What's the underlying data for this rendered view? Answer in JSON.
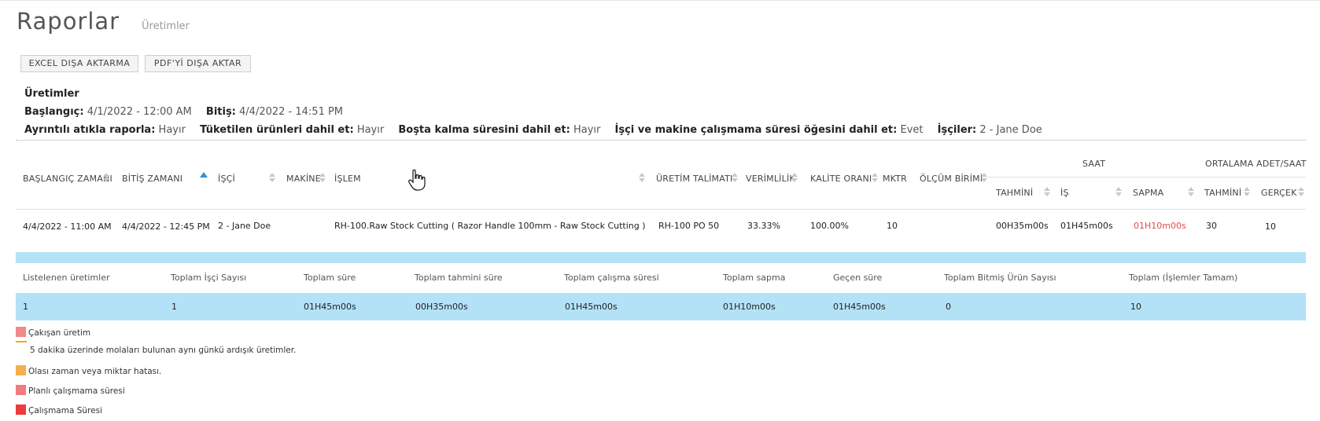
{
  "page": {
    "title": "Raporlar",
    "subtitle": "Üretimler"
  },
  "toolbar": {
    "excel_label": "EXCEL DIŞA AKTARMA",
    "pdf_label": "PDF'Yİ DIŞA AKTAR"
  },
  "filters": {
    "title": "Üretimler",
    "start_label": "Başlangıç:",
    "start_value": "4/1/2022 - 12:00 AM",
    "end_label": "Bitiş:",
    "end_value": "4/4/2022 - 14:51 PM",
    "scrap_label": "Ayrıntılı atıkla raporla:",
    "scrap_value": "Hayır",
    "consumed_label": "Tüketilen ürünleri dahil et:",
    "consumed_value": "Hayır",
    "idle_label": "Boşta kalma süresini dahil et:",
    "idle_value": "Hayır",
    "downtime_label": "İşçi ve makine çalışmama süresi öğesini dahil et:",
    "downtime_value": "Evet",
    "workers_label": "İşçiler:",
    "workers_value": "2 - Jane Doe"
  },
  "table": {
    "group_saat": "SAAT",
    "group_ort": "ORTALAMA ADET/SAAT",
    "columns": {
      "start": "BAŞLANGIÇ ZAMANI",
      "end": "BİTİŞ ZAMANI",
      "worker": "İŞÇİ",
      "machine": "MAKİNE",
      "operation": "İŞLEM",
      "order": "ÜRETİM TALİMATI",
      "efficiency": "VERİMLİLİK",
      "quality": "KALİTE ORANI",
      "qty": "MKTR",
      "unit": "ÖLÇÜM BİRİMİ",
      "est": "TAHMİNİ",
      "work": "İŞ",
      "dev": "SAPMA",
      "avg_est": "TAHMİNİ",
      "avg_act": "GERÇEK"
    },
    "row": {
      "start": "4/4/2022 - 11:00 AM",
      "end": "4/4/2022 - 12:45 PM",
      "worker": "2 - Jane Doe",
      "machine": "",
      "operation": "RH-100.Raw Stock Cutting ( Razor Handle 100mm - Raw Stock Cutting )",
      "order": "RH-100 PO 50",
      "efficiency": "33.33%",
      "quality": "100.00%",
      "qty": "10",
      "unit": "",
      "est": "00H35m00s",
      "work": "01H45m00s",
      "dev": "01H10m00s",
      "avg_est": "30",
      "avg_act": "10"
    }
  },
  "summary": {
    "headers": [
      "Listelenen üretimler",
      "Toplam İşçi Sayısı",
      "Toplam süre",
      "Toplam tahmini süre",
      "Toplam çalışma süresi",
      "Toplam sapma",
      "Geçen süre",
      "Toplam Bitmiş Ürün Sayısı",
      "Toplam (İşlemler Tamam)"
    ],
    "values": [
      "1",
      "1",
      "01H45m00s",
      "00H35m00s",
      "01H45m00s",
      "01H10m00s",
      "01H45m00s",
      "0",
      "10"
    ]
  },
  "legend": [
    {
      "label": "Çakışan üretim",
      "color": "#f08a8a"
    },
    {
      "label": "5 dakika üzerinde molaları bulunan aynı günkü ardışık üretimler.",
      "color": "#f5a623"
    },
    {
      "label": "Olası zaman veya miktar hatası.",
      "color": "#f5b04a"
    },
    {
      "label": "Planlı çalışmama süresi",
      "color": "#f07c7c"
    },
    {
      "label": "Çalışmama Süresi",
      "color": "#ee3b3b"
    }
  ],
  "colors": {
    "accent": "#2e8fd6",
    "summary_bg": "#b3e2f6",
    "deviation": "#e24a4a"
  }
}
